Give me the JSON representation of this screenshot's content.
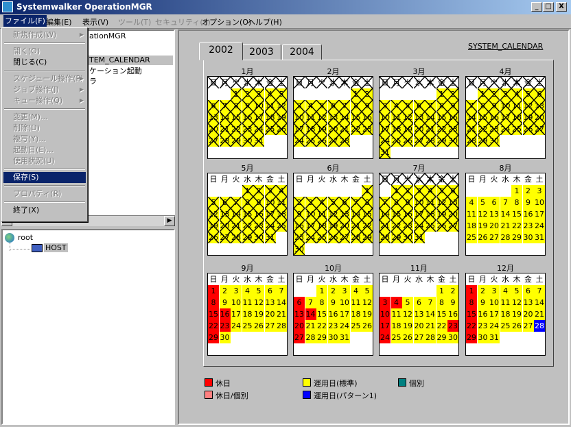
{
  "window": {
    "title": "Systemwalker OperationMGR"
  },
  "title_buttons": [
    "_",
    "□",
    "X"
  ],
  "menubar": [
    {
      "label": "ファイル(F)",
      "enabled": true,
      "open": true
    },
    {
      "label": "編集(E)",
      "enabled": true
    },
    {
      "label": "表示(V)",
      "enabled": true
    },
    {
      "label": "ツール(T)",
      "enabled": false
    },
    {
      "label": "セキュリティ(S)",
      "enabled": false
    },
    {
      "label": "オプション(O)",
      "enabled": true
    },
    {
      "label": "ヘルプ(H)",
      "enabled": true
    }
  ],
  "file_menu": [
    {
      "label": "新規作成(W)",
      "enabled": false,
      "submenu": true
    },
    {
      "sep": true
    },
    {
      "label": "開く(O)",
      "enabled": false
    },
    {
      "label": "閉じる(C)",
      "enabled": true
    },
    {
      "sep": true
    },
    {
      "label": "スケジュール操作(P)",
      "enabled": false,
      "submenu": true
    },
    {
      "label": "ジョブ操作(J)",
      "enabled": false,
      "submenu": true
    },
    {
      "label": "キュー操作(Q)",
      "enabled": false,
      "submenu": true
    },
    {
      "sep": true
    },
    {
      "label": "変更(M)...",
      "enabled": false
    },
    {
      "label": "削除(D)",
      "enabled": false
    },
    {
      "label": "複写(Y)...",
      "enabled": false
    },
    {
      "label": "起動日(E)...",
      "enabled": false
    },
    {
      "label": "使用状況(U)",
      "enabled": false
    },
    {
      "sep": true
    },
    {
      "label": "保存(S)",
      "enabled": true,
      "selected": true
    },
    {
      "sep": true
    },
    {
      "label": "プロパティ(R)",
      "enabled": false
    },
    {
      "sep": true
    },
    {
      "label": "終了(X)",
      "enabled": true
    }
  ],
  "left_tree_top": [
    {
      "label": "ationMGR"
    },
    {
      "label": "TEM_CALENDAR",
      "selected": true
    },
    {
      "label": "ケーション起動"
    },
    {
      "label": "ラ"
    }
  ],
  "left_tree_bottom": {
    "root": "root",
    "host": "HOST"
  },
  "tabs": [
    "2002",
    "2003",
    "2004"
  ],
  "calendar_name": "SYSTEM_CALENDAR",
  "weekday_headers": [
    "日",
    "月",
    "火",
    "水",
    "木",
    "金",
    "土"
  ],
  "year": 2002,
  "months": [
    {
      "label": "1月",
      "start": 2,
      "days": 31
    },
    {
      "label": "2月",
      "start": 5,
      "days": 28
    },
    {
      "label": "3月",
      "start": 5,
      "days": 31
    },
    {
      "label": "4月",
      "start": 1,
      "days": 30
    },
    {
      "label": "5月",
      "start": 3,
      "days": 31
    },
    {
      "label": "6月",
      "start": 6,
      "days": 30
    },
    {
      "label": "7月",
      "start": 1,
      "days": 31
    },
    {
      "label": "8月",
      "start": 4,
      "days": 31
    },
    {
      "label": "9月",
      "start": 0,
      "days": 30
    },
    {
      "label": "10月",
      "start": 2,
      "days": 31
    },
    {
      "label": "11月",
      "start": 5,
      "days": 30
    },
    {
      "label": "12月",
      "start": 0,
      "days": 31
    }
  ],
  "day_types": {
    "9": {
      "holiday": [
        1,
        8,
        15,
        16,
        22,
        23,
        29
      ],
      "pattern1": []
    },
    "10": {
      "holiday": [
        6,
        13,
        14,
        20,
        27
      ],
      "pattern1": []
    },
    "11": {
      "holiday": [
        3,
        4,
        10,
        17,
        23,
        24
      ],
      "pattern1": []
    },
    "12": {
      "holiday": [
        1,
        8,
        15,
        22,
        29
      ],
      "pattern1": [
        28
      ]
    }
  },
  "past_months": [
    1,
    2,
    3,
    4,
    5,
    6,
    7,
    8
  ],
  "crossed_days": {
    "1": [
      1,
      2,
      3,
      4,
      5,
      6,
      7,
      8,
      9,
      10,
      11,
      12,
      13,
      14,
      15,
      16,
      17,
      18,
      19,
      20,
      21,
      22,
      23,
      24,
      25,
      26,
      27,
      28,
      29,
      30,
      31
    ],
    "2": [
      1,
      2,
      3,
      4,
      5,
      6,
      7,
      8,
      9,
      10,
      11,
      12,
      13,
      14,
      15,
      16,
      17,
      18,
      19,
      20,
      21,
      22,
      23,
      24,
      25,
      26,
      27,
      28
    ],
    "3": [
      1,
      2,
      3,
      4,
      5,
      6,
      7,
      8,
      9,
      10,
      11,
      12,
      13,
      14,
      15,
      16,
      17,
      18,
      19,
      20,
      21,
      22,
      23,
      24,
      25,
      26,
      27,
      28,
      29,
      30,
      31
    ],
    "4": [
      1,
      2,
      3,
      4,
      5,
      6,
      7,
      8,
      9,
      10,
      11,
      12,
      13,
      14,
      15,
      16,
      17,
      18,
      19,
      20,
      21,
      22,
      23,
      24,
      25,
      26,
      27,
      28,
      29,
      30
    ],
    "5": [
      1,
      2,
      3,
      4,
      5,
      6,
      7,
      8,
      9,
      10,
      11,
      12,
      13,
      14,
      15,
      16,
      17,
      18,
      19,
      20,
      21,
      22,
      23,
      24,
      25,
      26,
      27,
      28,
      29,
      30,
      31
    ],
    "6": [
      1,
      2,
      3,
      4,
      5,
      6,
      7,
      8,
      9,
      10,
      11,
      12,
      13,
      14,
      15,
      16,
      17,
      18,
      19,
      20,
      21,
      22,
      23,
      24,
      25,
      26,
      27,
      28,
      29,
      30
    ],
    "7": [
      1,
      2,
      3,
      4,
      5,
      6,
      7,
      8,
      9,
      10,
      11,
      12,
      13,
      14,
      15,
      16,
      17,
      18,
      19,
      20,
      21,
      22,
      23,
      24,
      25,
      26,
      27,
      28,
      29,
      30,
      31
    ]
  },
  "crossed_headers_months": [
    1,
    2,
    3,
    4,
    7
  ],
  "legend": [
    {
      "label": "休日",
      "color": "#ff0000"
    },
    {
      "label": "運用日(標準)",
      "color": "#ffff00"
    },
    {
      "label": "個別",
      "color": "#008080"
    },
    {
      "label": "休日/個別",
      "color": "#ff8080"
    },
    {
      "label": "運用日(パターン1)",
      "color": "#0000ff"
    }
  ],
  "colors": {
    "holiday": "#ff0000",
    "normal": "#ffff00",
    "pattern1": "#0000ff",
    "selected_menu": "#0a246a"
  }
}
